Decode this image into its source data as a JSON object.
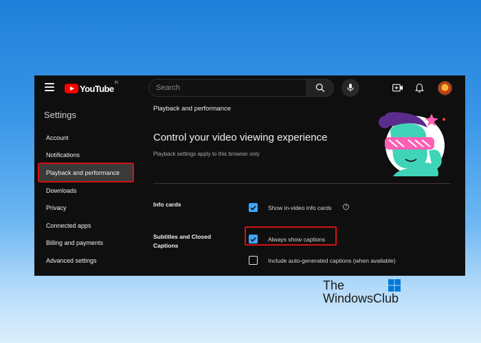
{
  "topbar": {
    "logo_text": "YouTube",
    "logo_region": "IN",
    "search_placeholder": "Search",
    "icons": [
      "menu-icon",
      "search-icon",
      "mic-icon",
      "create-video-icon",
      "bell-icon"
    ]
  },
  "sidebar": {
    "heading": "Settings",
    "items": [
      {
        "label": "Account"
      },
      {
        "label": "Notifications"
      },
      {
        "label": "Playback and performance",
        "active": true
      },
      {
        "label": "Downloads"
      },
      {
        "label": "Privacy"
      },
      {
        "label": "Connected apps"
      },
      {
        "label": "Billing and payments"
      },
      {
        "label": "Advanced settings"
      }
    ]
  },
  "main": {
    "section_title": "Playback and performance",
    "heading": "Control your video viewing experience",
    "subheading": "Playback settings apply to this browser only",
    "info_cards": {
      "label": "Info cards",
      "option": {
        "label": "Show in-video info cards",
        "checked": true
      }
    },
    "captions": {
      "label_line1": "Subtitles and Closed",
      "label_line2": "Captions",
      "options": [
        {
          "label": "Always show captions",
          "checked": true
        },
        {
          "label": "Include auto-generated captions (when available)",
          "checked": false
        }
      ]
    }
  },
  "colors": {
    "accent": "#3ea6ff",
    "highlight_border": "#d31313",
    "brand_red": "#ff0000",
    "window_bg": "#0f0f0f"
  },
  "watermark": {
    "line1": "The",
    "line2": "WindowsClub"
  }
}
